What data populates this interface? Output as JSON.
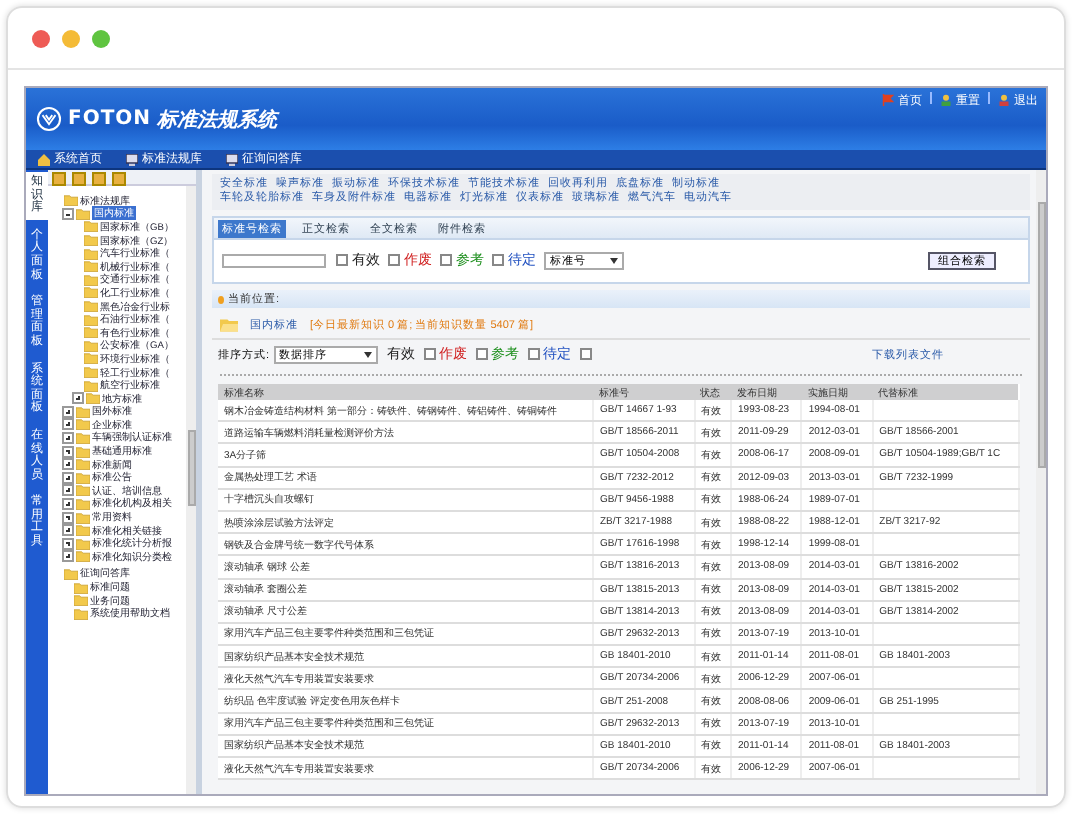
{
  "header": {
    "logo": "FOTON",
    "title": "标准法规系统",
    "links": [
      {
        "label": "首页"
      },
      {
        "label": "重置"
      },
      {
        "label": "退出"
      }
    ]
  },
  "nav": [
    {
      "label": "系统首页"
    },
    {
      "label": "标准法规库"
    },
    {
      "label": "征询问答库"
    }
  ],
  "side_tabs": [
    {
      "label": "知识库",
      "selected": true
    },
    {
      "label": "个人面板",
      "selected": false
    },
    {
      "label": "管理面板",
      "selected": false
    },
    {
      "label": "系统面板",
      "selected": false
    },
    {
      "label": "在线人员",
      "selected": false
    },
    {
      "label": "常用工具",
      "selected": false
    }
  ],
  "tree": [
    {
      "label": "标准法规库",
      "selected": false,
      "children": [
        {
          "label": "国内标准",
          "selected": true,
          "expanded": true,
          "children": [
            {
              "label": "国家标准（GB）",
              "selected": false
            },
            {
              "label": "国家标准（GZ）",
              "selected": false
            },
            {
              "label": "汽车行业标准（",
              "selected": false
            },
            {
              "label": "机械行业标准（",
              "selected": false
            },
            {
              "label": "交通行业标准（",
              "selected": false
            },
            {
              "label": "化工行业标准（",
              "selected": false
            },
            {
              "label": "黑色冶金行业标",
              "selected": false
            },
            {
              "label": "石油行业标准（",
              "selected": false
            },
            {
              "label": "有色行业标准（",
              "selected": false
            },
            {
              "label": "公安标准（GA）",
              "selected": false
            },
            {
              "label": "环境行业标准（",
              "selected": false
            },
            {
              "label": "轻工行业标准（",
              "selected": false
            },
            {
              "label": "航空行业标准",
              "selected": false
            },
            {
              "label": "地方标准",
              "selected": false,
              "expanded": false
            }
          ]
        },
        {
          "label": "国外标准",
          "selected": false,
          "expanded": false
        },
        {
          "label": "企业标准",
          "selected": false,
          "expanded": false
        },
        {
          "label": "车辆强制认证标准",
          "selected": false,
          "expanded": false
        },
        {
          "label": "基础通用标准",
          "selected": false,
          "expanded": false
        },
        {
          "label": "标准新闻",
          "selected": false,
          "expanded": false
        },
        {
          "label": "标准公告",
          "selected": false,
          "expanded": false
        },
        {
          "label": "认证、培训信息",
          "selected": false,
          "expanded": false
        },
        {
          "label": "标准化机构及相关",
          "selected": false,
          "expanded": false
        },
        {
          "label": "常用资料",
          "selected": false,
          "expanded": false
        },
        {
          "label": "标准化相关链接",
          "selected": false,
          "expanded": false
        },
        {
          "label": "标准化统计分析报",
          "selected": false,
          "expanded": false
        },
        {
          "label": "标准化知识分类检",
          "selected": false,
          "expanded": false
        }
      ]
    },
    {
      "label": "征询问答库",
      "selected": false,
      "children": [
        {
          "label": "标准问题",
          "selected": false
        },
        {
          "label": "业务问题",
          "selected": false
        },
        {
          "label": "系统使用帮助文档",
          "selected": false
        }
      ]
    }
  ],
  "category_links": [
    [
      "安全标准",
      "噪声标准",
      "振动标准",
      "环保技术标准",
      "节能技术标准",
      "回收再利用",
      "底盘标准",
      "制动标准"
    ],
    [
      "车轮及轮胎标准",
      "车身及附件标准",
      "电器标准",
      "灯光标准",
      "仪表标准",
      "玻璃标准",
      "燃气汽车",
      "电动汽车"
    ]
  ],
  "search": {
    "tabs": [
      {
        "label": "标准号检索",
        "selected": true
      },
      {
        "label": "正文检索",
        "selected": false
      },
      {
        "label": "全文检索",
        "selected": false
      },
      {
        "label": "附件检索",
        "selected": false
      }
    ],
    "filters": [
      {
        "label": "有效",
        "checked": false,
        "color": "#222222"
      },
      {
        "label": "作废",
        "checked": false,
        "color": "#d02020"
      },
      {
        "label": "参考",
        "checked": false,
        "color": "#209020"
      },
      {
        "label": "待定",
        "checked": false,
        "color": "#2050c0"
      }
    ],
    "field_select": "标准号",
    "button": "组合检索"
  },
  "location": {
    "label": "当前位置:"
  },
  "info": {
    "category": "国内标准",
    "summary": "[今日最新知识 0 篇; 当前知识数量 5407 篇]"
  },
  "sort": {
    "label": "排序方式:",
    "select": "数据排序",
    "filters": [
      {
        "label": "有效",
        "checked": false,
        "color": "#222222"
      },
      {
        "label": "作废",
        "checked": false,
        "color": "#d02020"
      },
      {
        "label": "参考",
        "checked": false,
        "color": "#209020"
      },
      {
        "label": "待定",
        "checked": false,
        "color": "#2050c0"
      }
    ],
    "download": "下载列表文件"
  },
  "table": {
    "columns": [
      "标准名称",
      "标准号",
      "状态",
      "发布日期",
      "实施日期",
      "代替标准"
    ],
    "rows": [
      {
        "name": "钢木冶金铸造结构材料 第一部分：铸铁件、铸钢铸件、铸铝铸件、铸铜铸件",
        "number": "GB/T 14667 1-93",
        "status": "有效",
        "published": "1993-08-23",
        "effective": "1994-08-01"
      },
      {
        "name": "道路运输车辆燃料消耗量检测评价方法",
        "number": "GB/T 18566-2011",
        "status": "有效",
        "published": "2011-09-29",
        "effective": "2012-03-01",
        "replaces": "GB/T 18566-2001"
      },
      {
        "name": "3A分子筛",
        "number": "GB/T 10504-2008",
        "status": "有效",
        "published": "2008-06-17",
        "effective": "2008-09-01",
        "replaces": "GB/T 10504-1989;GB/T 1C"
      },
      {
        "name": "金属热处理工艺 术语",
        "number": "GB/T 7232-2012",
        "status": "有效",
        "published": "2012-09-03",
        "effective": "2013-03-01",
        "replaces": "GB/T 7232-1999"
      },
      {
        "name": "十字槽沉头自攻螺钉",
        "number": "GB/T 9456-1988",
        "status": "有效",
        "published": "1988-06-24",
        "effective": "1989-07-01"
      },
      {
        "name": "热喷涂涂层试验方法评定",
        "number": "ZB/T 3217-1988",
        "status": "有效",
        "published": "1988-08-22",
        "effective": "1988-12-01",
        "replaces": "ZB/T 3217-92"
      },
      {
        "name": "钢铁及合金牌号统一数字代号体系",
        "number": "GB/T 17616-1998",
        "status": "有效",
        "published": "1998-12-14",
        "effective": "1999-08-01"
      },
      {
        "name": "滚动轴承 钢球 公差",
        "number": "GB/T 13816-2013",
        "status": "有效",
        "published": "2013-08-09",
        "effective": "2014-03-01",
        "replaces": "GB/T 13816-2002"
      },
      {
        "name": "滚动轴承 套圈公差",
        "number": "GB/T 13815-2013",
        "status": "有效",
        "published": "2013-08-09",
        "effective": "2014-03-01",
        "replaces": "GB/T 13815-2002"
      },
      {
        "name": "滚动轴承 尺寸公差",
        "number": "GB/T 13814-2013",
        "status": "有效",
        "published": "2013-08-09",
        "effective": "2014-03-01",
        "replaces": "GB/T 13814-2002"
      },
      {
        "name": "家用汽车产品三包主要零件种类范围和三包凭证",
        "number": "GB/T 29632-2013",
        "status": "有效",
        "published": "2013-07-19",
        "effective": "2013-10-01"
      },
      {
        "name": "国家纺织产品基本安全技术规范",
        "number": "GB 18401-2010",
        "status": "有效",
        "published": "2011-01-14",
        "effective": "2011-08-01",
        "replaces": "GB 18401-2003"
      },
      {
        "name": "液化天然气汽车专用装置安装要求",
        "number": "GB/T 20734-2006",
        "status": "有效",
        "published": "2006-12-29",
        "effective": "2007-06-01"
      },
      {
        "name": "纺织品 色牢度试验 评定变色用灰色样卡",
        "number": "GB/T 251-2008",
        "status": "有效",
        "published": "2008-08-06",
        "effective": "2009-06-01",
        "replaces": "GB 251-1995"
      },
      {
        "name": "家用汽车产品三包主要零件种类范围和三包凭证",
        "number": "GB/T 29632-2013",
        "status": "有效",
        "published": "2013-07-19",
        "effective": "2013-10-01"
      },
      {
        "name": "国家纺织产品基本安全技术规范",
        "number": "GB 18401-2010",
        "status": "有效",
        "published": "2011-01-14",
        "effective": "2011-08-01",
        "replaces": "GB 18401-2003"
      },
      {
        "name": "液化天然气汽车专用装置安装要求",
        "number": "GB/T 20734-2006",
        "status": "有效",
        "published": "2006-12-29",
        "effective": "2007-06-01"
      }
    ]
  }
}
